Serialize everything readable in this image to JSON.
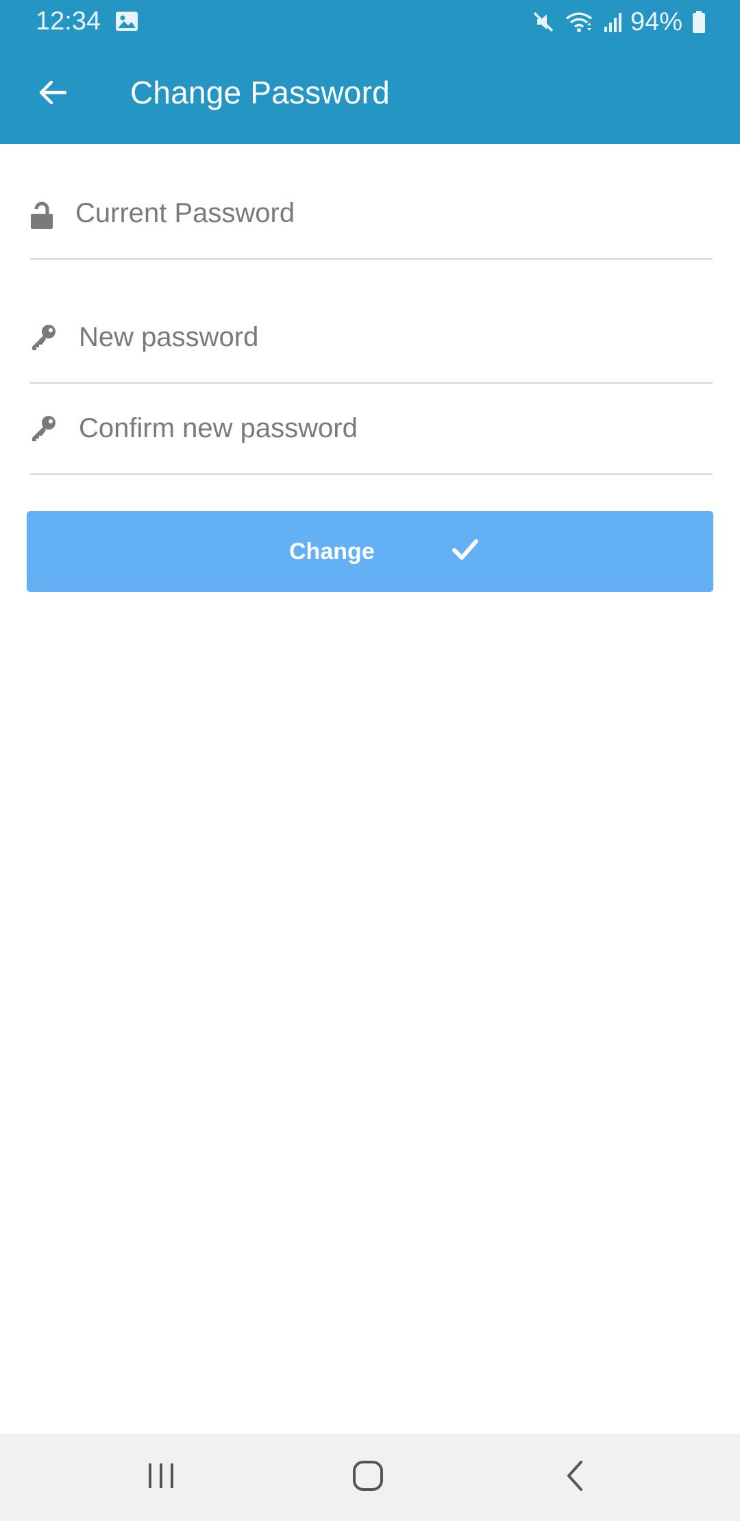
{
  "status_bar": {
    "time": "12:34",
    "battery": "94%",
    "icons": [
      "image-icon",
      "mute-icon",
      "wifi-icon",
      "signal-icon",
      "battery-icon"
    ]
  },
  "app_bar": {
    "title": "Change Password",
    "back_icon": "arrow-left-icon",
    "background": "#2596c4"
  },
  "form": {
    "current_password": {
      "placeholder": "Current Password",
      "value": "",
      "icon": "unlock-icon"
    },
    "new_password": {
      "placeholder": "New password",
      "value": "",
      "icon": "key-icon"
    },
    "confirm_password": {
      "placeholder": "Confirm new password",
      "value": "",
      "icon": "key-icon"
    },
    "submit": {
      "label": "Change",
      "icon": "check-icon",
      "color": "#63b0f4"
    }
  },
  "nav_bar": {
    "buttons": [
      "recents-icon",
      "home-icon",
      "back-icon"
    ]
  }
}
